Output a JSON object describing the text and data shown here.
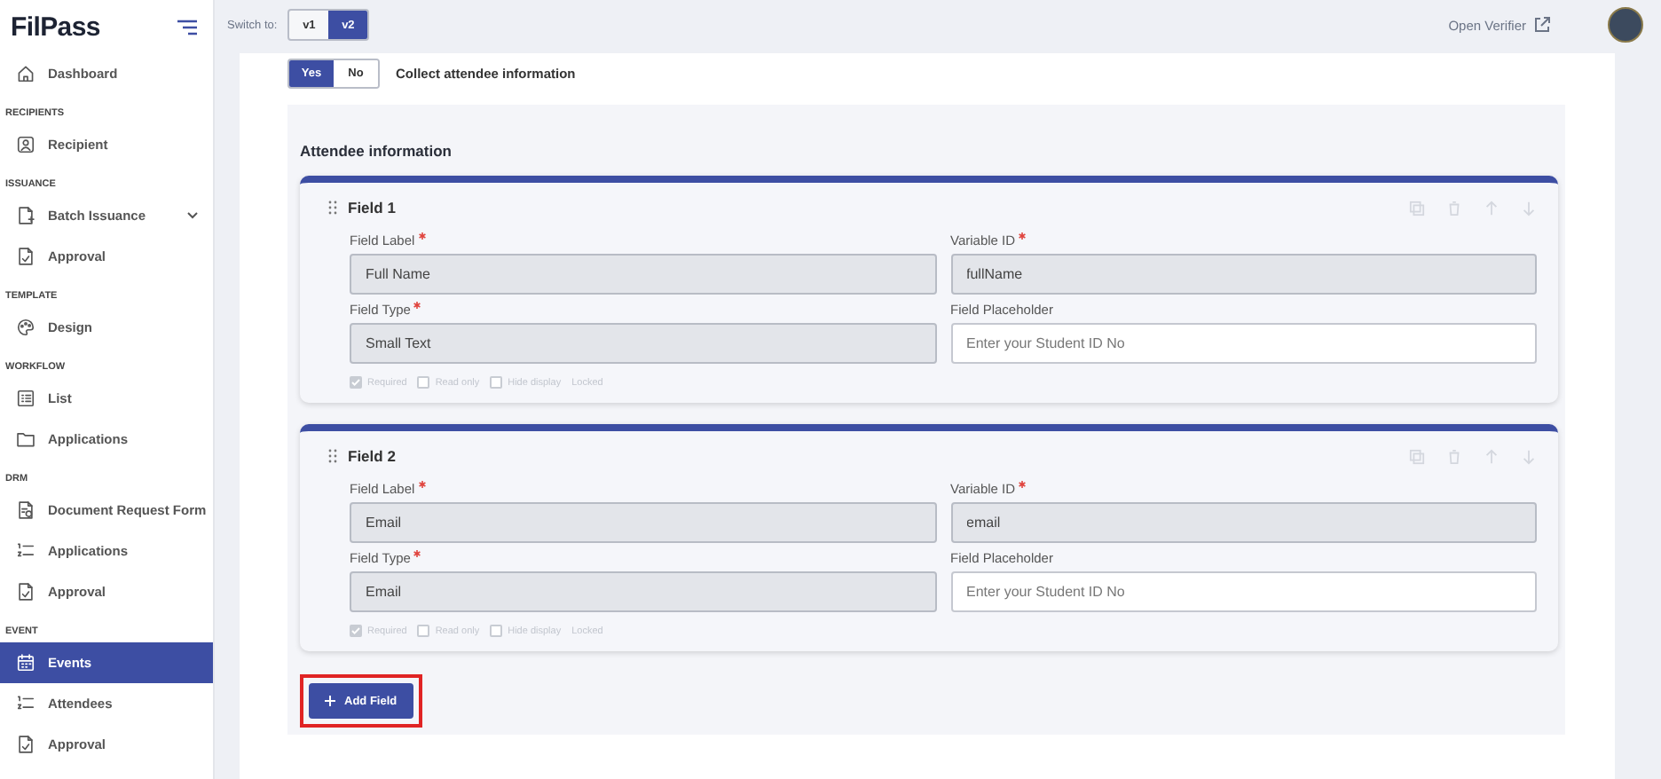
{
  "sidebar": {
    "logo": "FilPass",
    "sections": [
      {
        "items": [
          {
            "label": "Dashboard",
            "kind": "link",
            "selected": false
          }
        ]
      },
      {
        "title": "RECIPIENTS",
        "items": [
          {
            "label": "Recipient",
            "kind": "link",
            "selected": false
          }
        ]
      },
      {
        "title": "ISSUANCE",
        "items": [
          {
            "label": "Batch Issuance",
            "kind": "expandable",
            "selected": false
          },
          {
            "label": "Approval",
            "kind": "link",
            "selected": false
          }
        ]
      },
      {
        "title": "TEMPLATE",
        "items": [
          {
            "label": "Design",
            "kind": "link",
            "selected": false
          }
        ]
      },
      {
        "title": "WORKFLOW",
        "items": [
          {
            "label": "List",
            "kind": "link",
            "selected": false
          },
          {
            "label": "Applications",
            "kind": "link",
            "selected": false
          }
        ]
      },
      {
        "title": "DRM",
        "items": [
          {
            "label": "Document Request Form",
            "kind": "link",
            "selected": false
          },
          {
            "label": "Applications",
            "kind": "link",
            "selected": false
          },
          {
            "label": "Approval",
            "kind": "link",
            "selected": false
          }
        ]
      },
      {
        "title": "EVENT",
        "items": [
          {
            "label": "Events",
            "kind": "link",
            "selected": true
          },
          {
            "label": "Attendees",
            "kind": "link",
            "selected": false
          },
          {
            "label": "Approval",
            "kind": "link",
            "selected": false
          }
        ]
      }
    ]
  },
  "top_bar": {
    "switch_label": "Switch to:",
    "versions": [
      {
        "label": "v1",
        "selected": false
      },
      {
        "label": "v2",
        "selected": true
      }
    ],
    "open_verifier": "Open Verifier"
  },
  "form": {
    "collect_toggle": [
      {
        "label": "Yes",
        "selected": true
      },
      {
        "label": "No",
        "selected": false
      }
    ],
    "collect_label": "Collect attendee information",
    "attendee_section": {
      "title": "Attendee information",
      "fields": [
        {
          "title": "Field 1",
          "inputs": [
            {
              "label": "Field Label",
              "required": true,
              "readonly": true,
              "value": "Full Name"
            },
            {
              "label": "Variable ID",
              "required": true,
              "readonly": true,
              "value": "fullName"
            },
            {
              "label": "Field Type",
              "required": true,
              "readonly": true,
              "value": "Small Text"
            },
            {
              "label": "Field Placeholder",
              "required": false,
              "readonly": false,
              "placeholder": "Enter your Student ID No"
            }
          ],
          "options": [
            {
              "kind": "checkbox",
              "label": "Required",
              "checked": true,
              "disabled": true
            },
            {
              "kind": "checkbox",
              "label": "Read only",
              "checked": false,
              "disabled": true
            },
            {
              "kind": "checkbox",
              "label": "Hide display",
              "checked": false,
              "disabled": true
            },
            {
              "kind": "text",
              "label": "Locked",
              "disabled": true
            }
          ]
        },
        {
          "title": "Field 2",
          "inputs": [
            {
              "label": "Field Label",
              "required": true,
              "readonly": true,
              "value": "Email"
            },
            {
              "label": "Variable ID",
              "required": true,
              "readonly": true,
              "value": "email"
            },
            {
              "label": "Field Type",
              "required": true,
              "readonly": true,
              "value": "Email"
            },
            {
              "label": "Field Placeholder",
              "required": false,
              "readonly": false,
              "placeholder": "Enter your Student ID No"
            }
          ],
          "options": [
            {
              "kind": "checkbox",
              "label": "Required",
              "checked": true,
              "disabled": true
            },
            {
              "kind": "checkbox",
              "label": "Read only",
              "checked": false,
              "disabled": true
            },
            {
              "kind": "checkbox",
              "label": "Hide display",
              "checked": false,
              "disabled": true
            },
            {
              "kind": "text",
              "label": "Locked",
              "disabled": true
            }
          ]
        }
      ]
    },
    "add_button": {
      "label": "Add Field",
      "highlighted": true
    }
  }
}
